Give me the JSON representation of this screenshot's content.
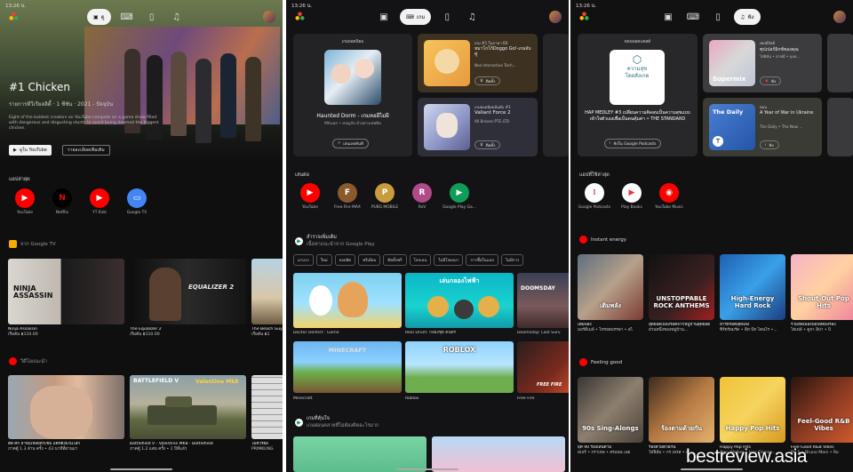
{
  "status_bar": {
    "p1": "13:26 น.",
    "p2": "13:26 น.",
    "p3": "13:26 น."
  },
  "nav": {
    "p1_selected": "ดู",
    "p2_selected": "เกม",
    "p3_selected": "ฟัง"
  },
  "panel1": {
    "hero_title": "#1 Chicken",
    "hero_meta": "รายการทีวีเรียลลิตี้ · 1 ซีซัน · 2021 - ปัจจุบัน",
    "hero_desc": "Eight of the boldest creators on YouTube compete on a game show filled with dangerous and disgusting stunts to avoid being deemed the biggest chicken.",
    "watch_button": "ดูใน YouTube",
    "more_button": "รายละเอียดเพิ่มเติม",
    "apps_title": "แอปล่าสุด",
    "apps": [
      {
        "name": "YouTube",
        "icon": "youtube-icon",
        "color": "#ff0000",
        "glyph": "▶"
      },
      {
        "name": "Netflix",
        "icon": "netflix-icon",
        "color": "#000000",
        "glyph": "N"
      },
      {
        "name": "YT Kids",
        "icon": "yt-kids-icon",
        "color": "#ff0000",
        "glyph": "▶"
      },
      {
        "name": "Google TV",
        "icon": "google-tv-icon",
        "color": "#4285f4",
        "glyph": "▭"
      }
    ],
    "section_gtv": "จาก Google TV",
    "movies": [
      {
        "title": "Ninja Assassin",
        "price": "เริ่มต้น ฿110.00",
        "art": "NINJA ASSASSIN"
      },
      {
        "title": "The Equalizer 2",
        "price": "เริ่มต้น ฿110.00",
        "art": "EQUALIZER 2"
      },
      {
        "title": "The Beach Guys",
        "price": "เริ่มต้น ฿1"
      }
    ],
    "section_yt": "วิดีโอแนะนำ",
    "videos": [
      {
        "title": "ติด ศึก อาจมีเหลือตัวเข้ม แค่ที่ยังมีในโลก",
        "meta": "ภาคตู้ 1.3 ล้าน ครั้ง • 43 นาทีที่ผ่านมา"
      },
      {
        "title": "Battlefield V - Valentine MK8 - Battlefield",
        "meta": "ภาคตู้ 1.2 แสน ครั้ง • 1 ปีที่แล้ว",
        "art": "Valentine Mk8",
        "art2": "BATTLEFIELD V"
      },
      {
        "title": "ไม่ควรฝ่อ",
        "meta": "PRIMKUNG"
      }
    ]
  },
  "panel2": {
    "feat_label": "เกมยอดนิยม",
    "feat_title": "Haunted Dorm - เกมหอผีไม่ผี",
    "feat_dev": "Mituan • ผจญภัย ผ้าอย่างเสพติด",
    "feat_btn": "เล่นเลยทันที",
    "side": [
      {
        "rank": "เกม #1 ในภาษา 60",
        "title": "หมาโกโก้Doggo Go!-เกมจับคู่",
        "dev": "Nox Interactive Tech...",
        "btn": "ติดตั้ง"
      },
      {
        "rank": "เกมยอดนิยมอันดับ #1",
        "title": "Valiant Force 2",
        "dev": "XII Braves PTE LTD",
        "btn": "ติดตั้ง"
      }
    ],
    "apps_title": "เล่นต่อ",
    "apps": [
      {
        "name": "YouTube",
        "icon": "youtube-icon",
        "color": "#ff0000",
        "glyph": "▶"
      },
      {
        "name": "Free Fire MAX",
        "icon": "free-fire-icon",
        "color": "#8b5a2b",
        "glyph": "F"
      },
      {
        "name": "PUBG MOBILE",
        "icon": "pubg-icon",
        "color": "#c89b3c",
        "glyph": "P"
      },
      {
        "name": "RoV",
        "icon": "rov-icon",
        "color": "#b04a8a",
        "glyph": "R"
      },
      {
        "name": "Google Play Ga...",
        "icon": "play-games-icon",
        "color": "#0f9d58",
        "glyph": "▶"
      }
    ],
    "sec1_title": "สำรวจเพิ่มเติม",
    "sec1_sub": "เนื้อหาแนะนำจาก Google Play",
    "chips": [
      "มาแรง",
      "ใหม่",
      "ยอดฮิต",
      "พรีเมียม",
      "ติดตั้งฟรี",
      "โลกเอน",
      "ไม่มีโฆษณา",
      "การซื้อในแอป",
      "ไม่มีการ"
    ],
    "games": [
      {
        "name": "Doctor Dentist : Game"
      },
      {
        "name": "Real Drum: กลองชุด ดนตรี",
        "art": "เล่นกลองไฟฟ้า"
      },
      {
        "name": "Doomsday: Last Surv",
        "art": "DOOMSDAY"
      },
      {
        "name": "Minecraft",
        "art": "MINECRAFT"
      },
      {
        "name": "Roblox",
        "art": "ROBLOX"
      },
      {
        "name": "Free Fire",
        "art": "FREE FIRE"
      }
    ],
    "sec2_title": "เกมที่คุ้นใจ",
    "sec2_sub": "เกมผ่อนคลายที่ไม่ต้องคิดอะไรมาก"
  },
  "panel3": {
    "feat_label": "ตอนพอดแคสต์",
    "feat_art1": "ความสุข",
    "feat_art2": "โดยสังเกต",
    "feat_title": "HAP MEDLEY #3 เปลี่ยนความคิดลบเป็นความสุขแบบเข้าใจตัวเองเพื่อเป็นคนคุ้มค่า • THE STANDARD",
    "feat_btn": "ฟังใน Google Podcasts",
    "side": [
      {
        "label": "เพลย์ลิสต์",
        "title": "ซุปเปอร์มิกซ์ของคุณ",
        "sub": "ไฮ่ฟิล์ม • ฮาชมี • ลุงท...",
        "art": "Supermix",
        "btn": "ฟัง"
      },
      {
        "label": "ตอน",
        "title": "A Year of War in Ukraine",
        "sub": "The Daily • The New ...",
        "art": "The Daily",
        "btn": "ฟัง"
      }
    ],
    "apps_title": "แอปที่ใช้ล่าสุด",
    "apps": [
      {
        "name": "Google Podcasts",
        "icon": "google-podcasts-icon",
        "color": "#ffffff",
        "glyph": "⁞"
      },
      {
        "name": "Play Books",
        "icon": "play-books-icon",
        "color": "#ffffff",
        "glyph": "▶"
      },
      {
        "name": "YouTube Music",
        "icon": "youtube-music-icon",
        "color": "#ff0000",
        "glyph": "◉"
      }
    ],
    "sec1_title": "Instant energy",
    "mixes1": [
      {
        "art": "เติมพลัง",
        "title": "เติมพลัง",
        "sub": "มอร์ดีเมล์ • ไทรอธพรรษา • สไ"
      },
      {
        "art": "UNSTOPPABLE ROCK ANTHEMS",
        "title": "สุดยอดเพลงร็อคจากหมู่บ้านสุดยอด",
        "sub": "ส่วนหนึ่งของหมู่บ้าน..."
      },
      {
        "art": "High-Energy Hard Rock",
        "title": "ฮาร์ดร็อคสุดพลัง",
        "sub": "ซิร์ตร้อมร์ด • อีท บีท โดนโร •..."
      },
      {
        "art": "Shout-Out Pop Hits",
        "title": "รวมฮิตเพลงป๊อปที่ต้องร้อง",
        "sub": "ไฮ่เฟล์ • ดูจา ลิปา • บิ"
      }
    ],
    "sec2_title": "Feeling good",
    "mixes2": [
      {
        "art": "90s Sing-Alongs",
        "title": "ยุค 90 ร้องเล่นตาม",
        "sub": "สเปร์ • กราเทล • สรแพน เลย"
      },
      {
        "art": "ร้องตามด้วยกัน",
        "title": "ร้องตามด้วยกัน",
        "sub": "ไฮ่ฟิล์ม • กร เพรส • เร..."
      },
      {
        "art": "Happy Pop Hits",
        "title": "Happy Pop Hits",
        "sub": "Alan Walker • Jess Glynne..."
      },
      {
        "art": "Feel-Good R&B Vibes",
        "title": "Feel-Good R&B Vibes",
        "sub": "Ms Ji • Bruno Mars • Ro"
      }
    ]
  },
  "watermark": "bestreview.asia"
}
